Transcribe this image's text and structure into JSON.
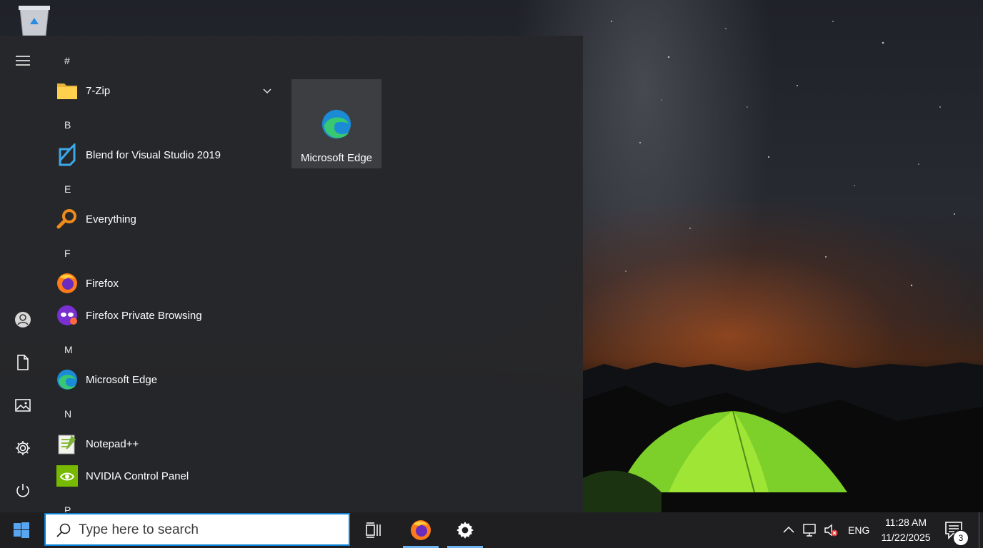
{
  "start_menu": {
    "groups": [
      {
        "letter": "#",
        "apps": [
          {
            "label": "7-Zip",
            "icon": "folder-icon",
            "expandable": true
          }
        ]
      },
      {
        "letter": "B",
        "apps": [
          {
            "label": "Blend for Visual Studio 2019",
            "icon": "blend-icon"
          }
        ]
      },
      {
        "letter": "E",
        "apps": [
          {
            "label": "Everything",
            "icon": "everything-search-icon"
          }
        ]
      },
      {
        "letter": "F",
        "apps": [
          {
            "label": "Firefox",
            "icon": "firefox-icon"
          },
          {
            "label": "Firefox Private Browsing",
            "icon": "firefox-private-icon"
          }
        ]
      },
      {
        "letter": "M",
        "apps": [
          {
            "label": "Microsoft Edge",
            "icon": "edge-icon"
          }
        ]
      },
      {
        "letter": "N",
        "apps": [
          {
            "label": "Notepad++",
            "icon": "notepadpp-icon"
          },
          {
            "label": "NVIDIA Control Panel",
            "icon": "nvidia-icon"
          }
        ]
      },
      {
        "letter": "P",
        "apps": []
      }
    ],
    "tile": {
      "label": "Microsoft Edge",
      "icon": "edge-icon"
    }
  },
  "taskbar": {
    "search_placeholder": "Type here to search",
    "language": "ENG",
    "time": "11:28 AM",
    "date": "11/22/2025",
    "notification_count": "3"
  },
  "colors": {
    "accent": "#0a7fd8",
    "start_menu_bg": "#26272a",
    "taskbar_bg": "#1f1f22",
    "tile_bg": "#3d3e42"
  }
}
